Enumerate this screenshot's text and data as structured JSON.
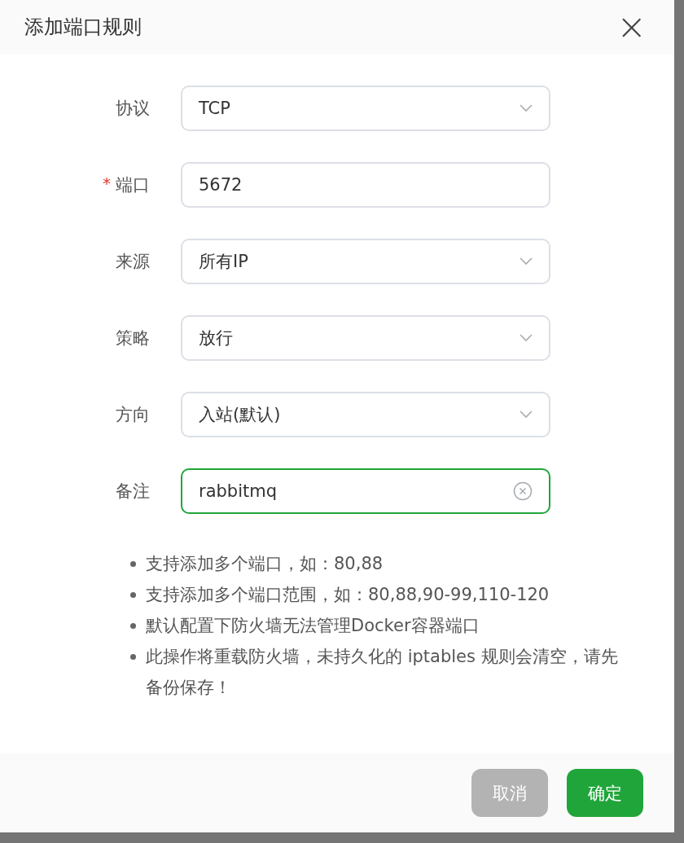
{
  "dialog": {
    "title": "添加端口规则",
    "close": "×"
  },
  "required_mark": "*",
  "fields": [
    {
      "label": "协议",
      "kind": "select",
      "value": "TCP",
      "required": false,
      "focused": false
    },
    {
      "label": "端口",
      "kind": "input",
      "value": "5672",
      "required": true,
      "focused": false
    },
    {
      "label": "来源",
      "kind": "select",
      "value": "所有IP",
      "required": false,
      "focused": false
    },
    {
      "label": "策略",
      "kind": "select",
      "value": "放行",
      "required": false,
      "focused": false
    },
    {
      "label": "方向",
      "kind": "select",
      "value": "入站(默认)",
      "required": false,
      "focused": false
    },
    {
      "label": "备注",
      "kind": "input",
      "value": "rabbitmq",
      "required": false,
      "focused": true
    }
  ],
  "notes": [
    "支持添加多个端口，如：80,88",
    "支持添加多个端口范围，如：80,88,90-99,110-120",
    "默认配置下防火墙无法管理Docker容器端口",
    "此操作将重载防火墙，未持久化的 iptables 规则会清空，请先备份保存！"
  ],
  "buttons": [
    {
      "label": "取消",
      "kind": "secondary",
      "disabled": true
    },
    {
      "label": "确定",
      "kind": "primary",
      "disabled": false
    }
  ]
}
